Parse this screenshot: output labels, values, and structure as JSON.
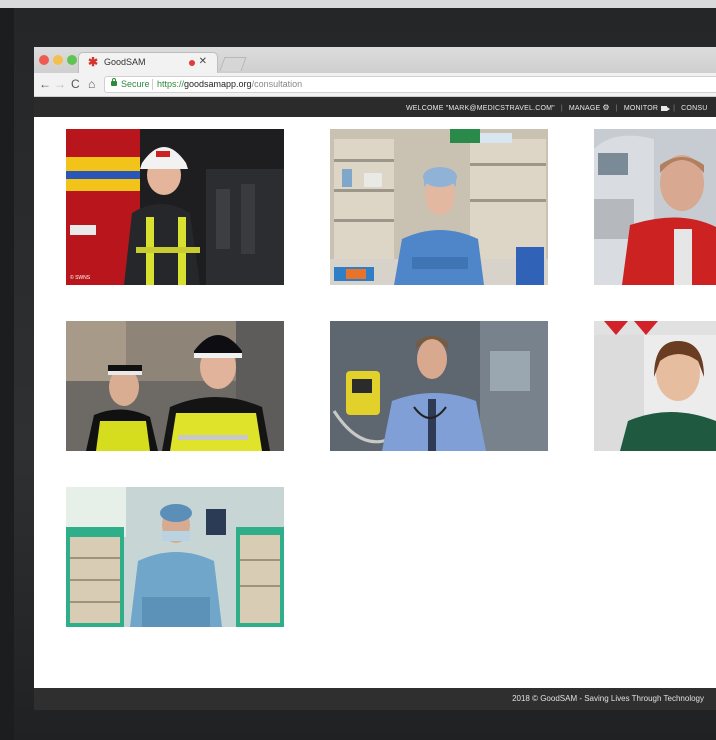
{
  "browser": {
    "tab_title": "GoodSAM",
    "secure_label": "Secure",
    "url_scheme": "https://",
    "url_domain": "goodsamapp.org",
    "url_path": "/consultation"
  },
  "site_nav": {
    "welcome": "WELCOME \"MARK@MEDICSTRAVEL.COM\"",
    "manage": "MANAGE",
    "monitor": "MONITOR",
    "consult": "CONSU"
  },
  "responders": [
    {
      "role": "firefighter",
      "credit": "© SWNS"
    },
    {
      "role": "surgeon"
    },
    {
      "role": "paramedic"
    },
    {
      "role": "police-officers"
    },
    {
      "role": "doctor"
    },
    {
      "role": "ambulance-medic"
    },
    {
      "role": "seated-surgeon"
    }
  ],
  "footer": {
    "text": "2018 © GoodSAM - Saving Lives Through Technology"
  }
}
